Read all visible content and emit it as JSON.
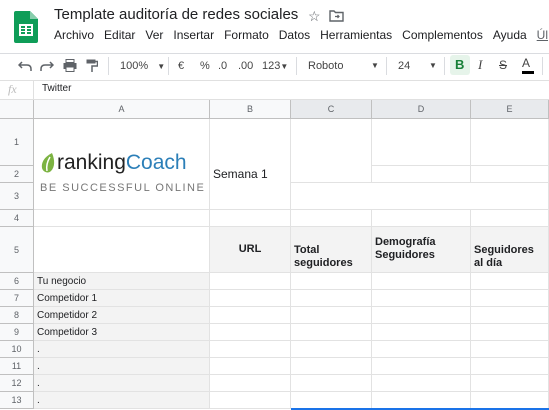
{
  "header": {
    "title": "Template auditoría de redes sociales",
    "menu": [
      "Archivo",
      "Editar",
      "Ver",
      "Insertar",
      "Formato",
      "Datos",
      "Herramientas",
      "Complementos",
      "Ayuda",
      "Úl"
    ]
  },
  "toolbar": {
    "zoom": "100%",
    "currency": "€",
    "percent": "%",
    "dec_less": ".0",
    "dec_more": ".00",
    "format_more": "123",
    "font": "Roboto",
    "font_size": "24",
    "bold": "B",
    "italic": "I",
    "strike": "S",
    "text_color": "A"
  },
  "formula_bar": {
    "fx": "fx",
    "value": "Twitter"
  },
  "sheet": {
    "columns": [
      "A",
      "B",
      "C",
      "D",
      "E"
    ],
    "rows": [
      "1",
      "2",
      "3",
      "4",
      "5",
      "6",
      "7",
      "8",
      "9",
      "10",
      "11",
      "12",
      "13"
    ],
    "logo_text_a": "ranking",
    "logo_text_b": "Coach",
    "logo_tagline": "BE SUCCESSFUL ONLINE",
    "semana": "Semana 1",
    "headers": [
      "URL",
      "Total seguidores",
      "Demografía Seguidores",
      "Seguidores al día"
    ],
    "entities": [
      "Tu negocio",
      "Competidor 1",
      "Competidor 2",
      "Competidor 3",
      ".",
      ".",
      ".",
      "."
    ]
  },
  "colors": {
    "sheets_green": "#0f9d58",
    "logo_green": "#7cb342",
    "logo_blue": "#2c7fb8",
    "selection": "#1a73e8"
  }
}
